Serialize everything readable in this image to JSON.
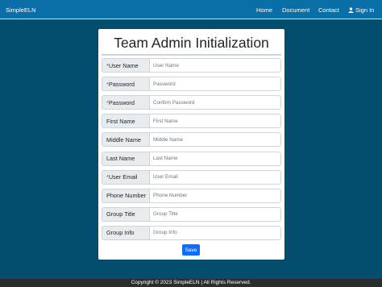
{
  "navbar": {
    "brand": "SimpleELN",
    "links": {
      "home": "Home",
      "document": "Document",
      "contact": "Contact",
      "sign_in": "Sign In",
      "sign_in_icon": "user-icon"
    }
  },
  "form": {
    "title": "Team Admin Initialization",
    "fields": [
      {
        "label": "User Name",
        "required": true,
        "placeholder": "User Name",
        "value": ""
      },
      {
        "label": "Password",
        "required": true,
        "placeholder": "Password",
        "value": ""
      },
      {
        "label": "Password",
        "required": true,
        "placeholder": "Confirm Password",
        "value": ""
      },
      {
        "label": "First Name",
        "required": false,
        "placeholder": "First Name",
        "value": ""
      },
      {
        "label": "Middle Name",
        "required": false,
        "placeholder": "Middle Name",
        "value": ""
      },
      {
        "label": "Last Name",
        "required": false,
        "placeholder": "Last Name",
        "value": ""
      },
      {
        "label": "User Email",
        "required": true,
        "placeholder": "User Email",
        "value": ""
      },
      {
        "label": "Phone Number",
        "required": false,
        "placeholder": "Phone Number",
        "value": ""
      },
      {
        "label": "Group Title",
        "required": false,
        "placeholder": "Group Title",
        "value": ""
      },
      {
        "label": "Group Info",
        "required": false,
        "placeholder": "Group Info",
        "value": ""
      }
    ],
    "required_marker": "*",
    "save_label": "Save"
  },
  "footer": {
    "text": "Copyright © 2023 SimpleELN | All Rights Reserved."
  },
  "colors": {
    "page_background": "#034e6f",
    "navbar": "#0a6fa6",
    "primary_button": "#0d6efd",
    "required_marker": "#dc3545",
    "footer": "#2c2c2c"
  }
}
